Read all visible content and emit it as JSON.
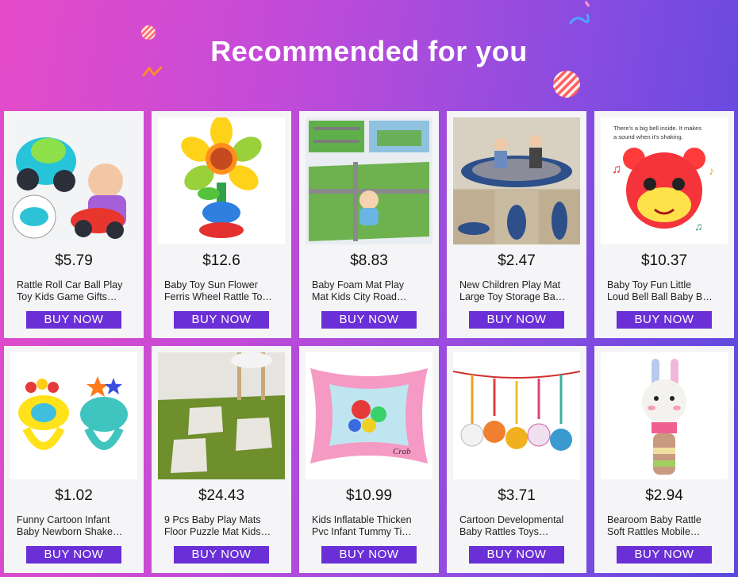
{
  "header": {
    "title": "Recommended for you"
  },
  "products": [
    {
      "price": "$5.79",
      "name1": "Rattle Roll Car Ball Play",
      "name2": "Toy Kids Game Gifts…",
      "cta": "BUY NOW",
      "image": "toy-car-rattle"
    },
    {
      "price": "$12.6",
      "name1": "Baby Toy Sun Flower",
      "name2": "Ferris Wheel Rattle To…",
      "cta": "BUY NOW",
      "image": "sunflower-rattle"
    },
    {
      "price": "$8.83",
      "name1": "Baby Foam Mat Play",
      "name2": "Mat Kids City Road…",
      "cta": "BUY NOW",
      "image": "city-road-play-mat"
    },
    {
      "price": "$2.47",
      "name1": "New Children Play Mat",
      "name2": "Large Toy Storage Ba…",
      "cta": "BUY NOW",
      "image": "toy-storage-mat"
    },
    {
      "price": "$10.37",
      "name1": "Baby Toy Fun Little",
      "name2": "Loud Bell Ball Baby B…",
      "cta": "BUY NOW",
      "image": "bell-ball-plush",
      "image_caption": "There's a big bell inside. It makes a sound when it's shaking."
    },
    {
      "price": "$1.02",
      "name1": "Funny Cartoon Infant",
      "name2": "Baby Newborn Shake…",
      "cta": "BUY NOW",
      "image": "hand-rattles"
    },
    {
      "price": "$24.43",
      "name1": "9 Pcs Baby Play Mats",
      "name2": "Floor Puzzle Mat Kids…",
      "cta": "BUY NOW",
      "image": "puzzle-floor-mat"
    },
    {
      "price": "$10.99",
      "name1": "Kids Inflatable Thicken",
      "name2": "Pvc Infant Tummy Ti…",
      "cta": "BUY NOW",
      "image": "inflatable-water-mat",
      "image_caption": "Crab"
    },
    {
      "price": "$3.71",
      "name1": "Cartoon Developmental",
      "name2": "Baby Rattles Toys…",
      "cta": "BUY NOW",
      "image": "hanging-rattles"
    },
    {
      "price": "$2.94",
      "name1": "Bearoom Baby Rattle",
      "name2": "Soft Rattles Mobile…",
      "cta": "BUY NOW",
      "image": "plush-stick-rattle"
    }
  ]
}
